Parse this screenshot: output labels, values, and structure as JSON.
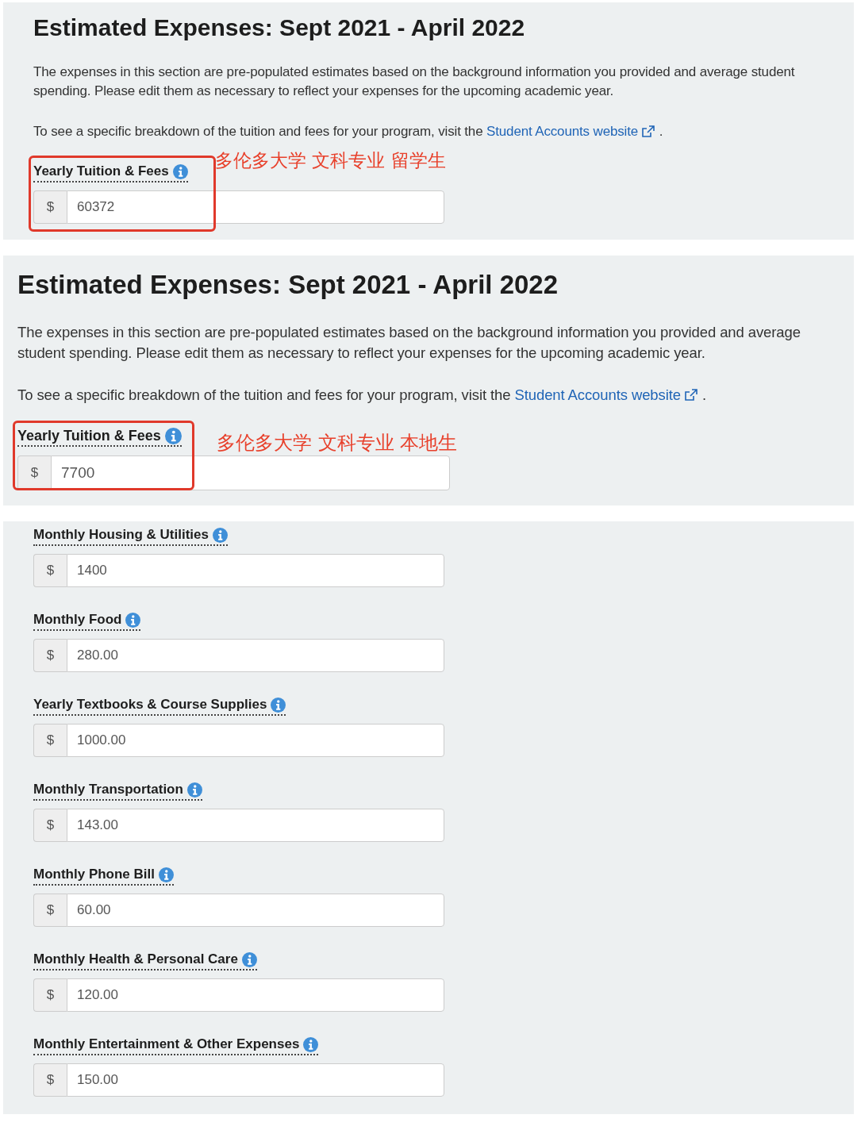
{
  "panels": [
    {
      "title": "Estimated Expenses: Sept 2021 - April 2022",
      "intro": "The expenses in this section are pre-populated estimates based on the background information you provided and average student spending. Please edit them as necessary to reflect your expenses for the upcoming academic year.",
      "link_prefix": "To see a specific breakdown of the tuition and fees for your program, visit the",
      "link": "Student Accounts website",
      "link_suffix": ".",
      "annotation": "多伦多大学 文科专业 留学生",
      "fields": [
        {
          "label": "Yearly Tuition & Fees",
          "prefix": "$",
          "value": "60372"
        }
      ]
    },
    {
      "title": "Estimated Expenses: Sept 2021 - April 2022",
      "intro": "The expenses in this section are pre-populated estimates based on the background information you provided and average student spending. Please edit them as necessary to reflect your expenses for the upcoming academic year.",
      "link_prefix": "To see a specific breakdown of the tuition and fees for your program, visit the",
      "link": "Student Accounts website",
      "link_suffix": ".",
      "annotation": "多伦多大学 文科专业 本地生",
      "fields": [
        {
          "label": "Yearly Tuition & Fees",
          "prefix": "$",
          "value": "7700"
        }
      ]
    },
    {
      "fields": [
        {
          "label": "Monthly Housing & Utilities",
          "prefix": "$",
          "value": "1400"
        },
        {
          "label": "Monthly Food",
          "prefix": "$",
          "value": "280.00"
        },
        {
          "label": "Yearly Textbooks & Course Supplies",
          "prefix": "$",
          "value": "1000.00"
        },
        {
          "label": "Monthly Transportation",
          "prefix": "$",
          "value": "143.00"
        },
        {
          "label": "Monthly Phone Bill",
          "prefix": "$",
          "value": "60.00"
        },
        {
          "label": "Monthly Health & Personal Care",
          "prefix": "$",
          "value": "120.00"
        },
        {
          "label": "Monthly Entertainment & Other Expenses",
          "prefix": "$",
          "value": "150.00"
        }
      ]
    }
  ]
}
